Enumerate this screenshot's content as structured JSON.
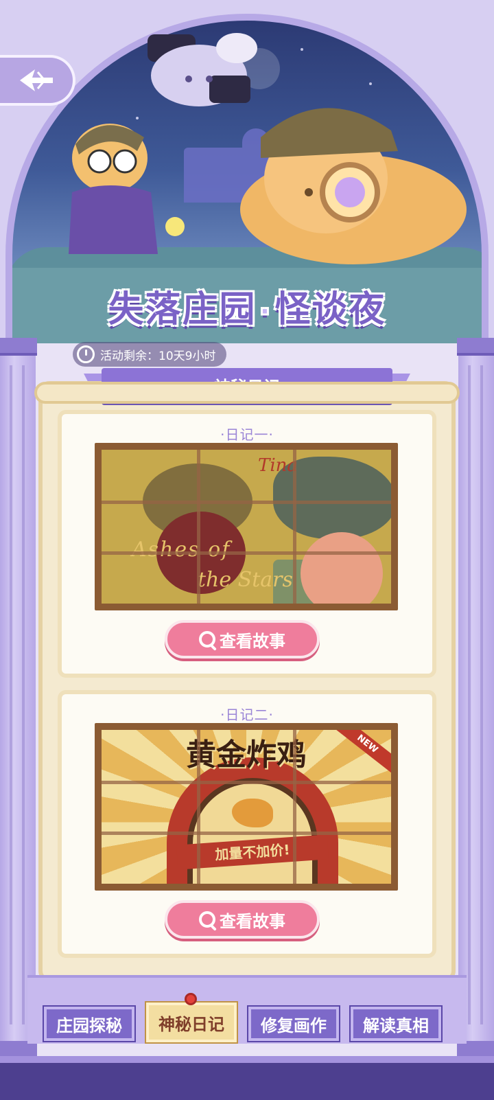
{
  "hero": {
    "title_part1": "失落庄园",
    "title_separator": "·",
    "title_part2": "怪谈夜"
  },
  "back_button": {
    "icon": "back-arrow-icon"
  },
  "timer": {
    "label": "活动剩余：",
    "value": "10天9小时"
  },
  "section": {
    "banner_title": "神秘日记"
  },
  "diaries": [
    {
      "title": "·日记一·",
      "art_text_line1": "Ashes of",
      "art_text_line2": "the Stars",
      "art_signature": "Tina",
      "button_label": "查看故事"
    },
    {
      "title": "·日记二·",
      "sign_title": "黄金炸鸡",
      "ribbon_text": "加量不加价!",
      "new_tag": "NEW",
      "button_label": "查看故事"
    }
  ],
  "bottom_nav": {
    "items": [
      {
        "label": "庄园探秘",
        "active": false
      },
      {
        "label": "神秘日记",
        "active": true
      },
      {
        "label": "修复画作",
        "active": false
      },
      {
        "label": "解读真相",
        "active": false
      }
    ]
  },
  "colors": {
    "accent_purple": "#7d69c9",
    "button_pink": "#ef7d9c",
    "active_tab": "#f3dea1"
  }
}
